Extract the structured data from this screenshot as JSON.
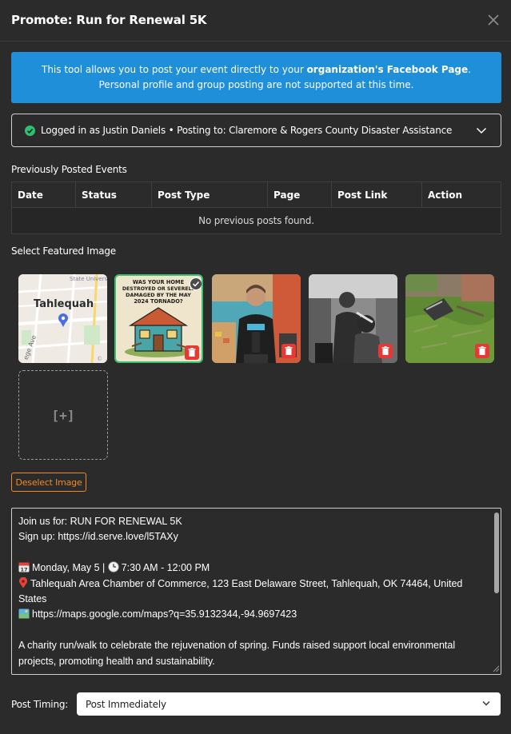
{
  "modal": {
    "title": "Promote: Run for Renewal 5K"
  },
  "banner": {
    "text_before": "This tool allows you to post your event directly to your ",
    "text_bold": "organization's Facebook Page",
    "text_after": ". Personal profile and group posting are not supported at this time."
  },
  "account": {
    "status_text": "Logged in as Justin Daniels • Posting to: Claremore & Rogers County Disaster Assistance"
  },
  "previous_posts": {
    "label": "Previously Posted Events",
    "columns": [
      "Date",
      "Status",
      "Post Type",
      "Page",
      "Post Link",
      "Action"
    ],
    "empty_text": "No previous posts found."
  },
  "featured_image": {
    "label": "Select Featured Image",
    "images": [
      {
        "name": "map",
        "map_label": "Tahlequah",
        "map_corner": "State Univers",
        "map_street": "ege Ave",
        "map_attribution": "©"
      },
      {
        "name": "tornado-poster",
        "selected": true,
        "poster_lines": [
          "WAS YOUR HOME",
          "DESTROYED OR SEVERELY",
          "DAMAGED BY THE MAY",
          "2024 TORNADO?"
        ]
      },
      {
        "name": "woman-photo"
      },
      {
        "name": "barber-photo"
      },
      {
        "name": "debris-photo"
      }
    ],
    "add_label": "[+]",
    "deselect_label": "Deselect Image"
  },
  "post": {
    "line1": "Join us for: RUN FOR RENEWAL 5K",
    "line2": "Sign up: https://id.serve.love/l5TAXy",
    "date_text": "Monday, May 5 | ",
    "time_text": "7:30 AM - 12:00 PM",
    "location_line1": "Tahlequah Area Chamber of Commerce, 123 East Delaware Street, Tahlequah, OK 74464,  United",
    "location_line2": "States",
    "maps_link": "https://maps.google.com/maps?q=35.9132344,-94.9697423",
    "description_line1": "A charity run/walk to celebrate the rejuvenation of spring. Funds raised support local environmental",
    "description_line2": "projects, promoting health and sustainability."
  },
  "timing": {
    "label": "Post Timing:",
    "value": "Post Immediately"
  },
  "colors": {
    "background": "#2b2b2b",
    "banner": "#1e8fd8",
    "success": "#2fbf71",
    "danger": "#e53935",
    "warning": "#f08a24"
  }
}
